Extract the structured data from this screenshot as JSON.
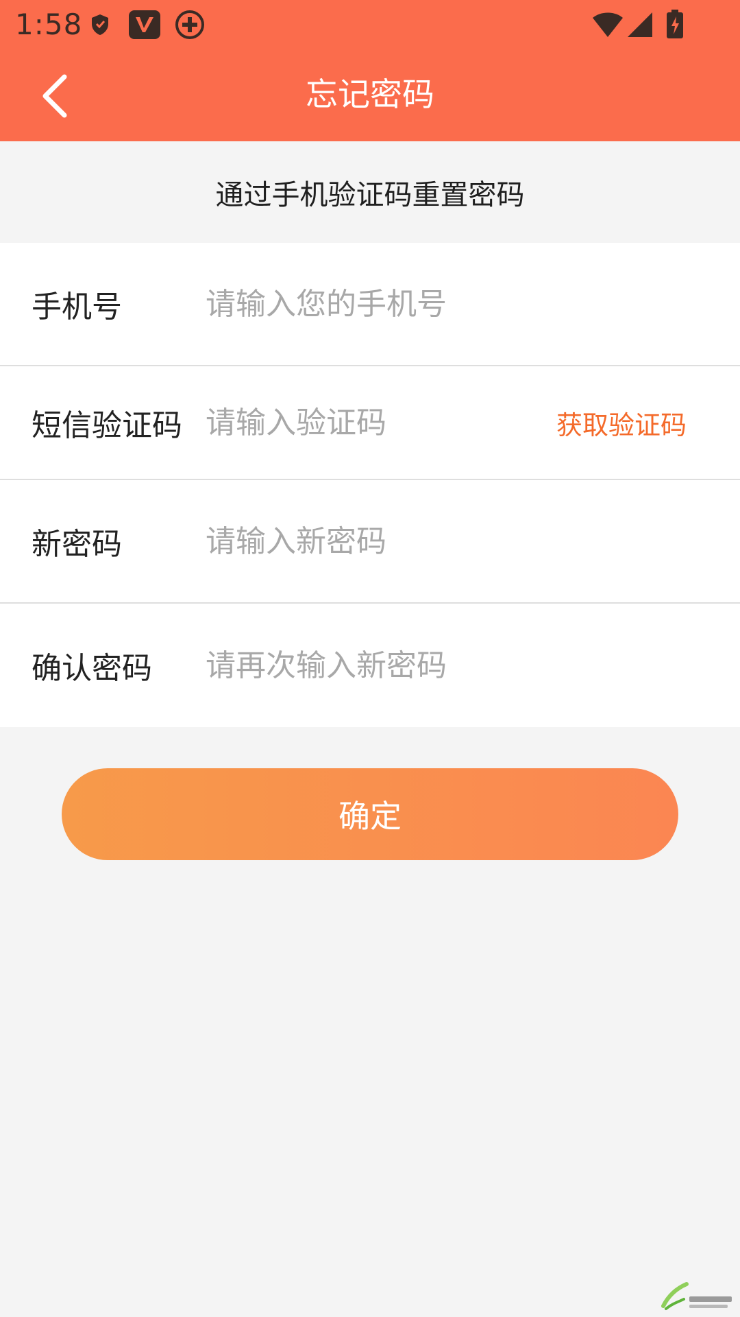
{
  "status_bar": {
    "time": "1:58",
    "icons": [
      "shield-icon",
      "vivaldi-v-icon",
      "add-circle-icon",
      "wifi-icon",
      "signal-icon",
      "battery-charging-icon"
    ]
  },
  "app_bar": {
    "title": "忘记密码",
    "back_icon": "chevron-left-icon"
  },
  "section": {
    "title": "通过手机验证码重置密码"
  },
  "form": {
    "phone": {
      "label": "手机号",
      "placeholder": "请输入您的手机号"
    },
    "sms_code": {
      "label": "短信验证码",
      "placeholder": "请输入验证码",
      "action": "获取验证码"
    },
    "new_password": {
      "label": "新密码",
      "placeholder": "请输入新密码"
    },
    "confirm_password": {
      "label": "确认密码",
      "placeholder": "请再次输入新密码"
    }
  },
  "confirm_button": {
    "label": "确定"
  },
  "colors": {
    "accent": "#fb6c4c",
    "action_text": "#f46a2a",
    "button_gradient_start": "#f79a4a",
    "button_gradient_end": "#fb8652"
  }
}
